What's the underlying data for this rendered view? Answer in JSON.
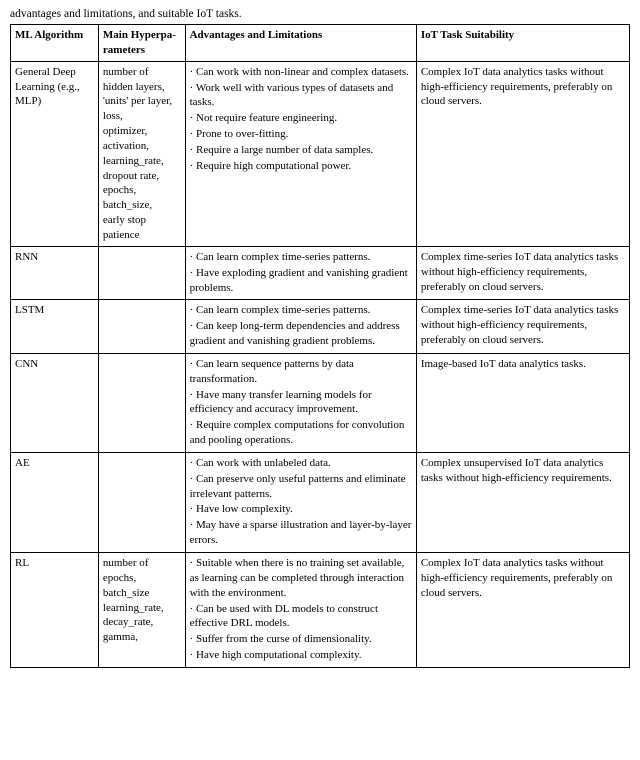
{
  "header": "advantages and limitations, and suitable IoT tasks.",
  "columns": [
    "ML Algorithm",
    "Main Hyperparameters",
    "Advantages and Limitations",
    "IoT Task Suitability"
  ],
  "rows": [
    {
      "algo": "General Deep Learning (e.g., MLP)",
      "params": "number of hidden layers,\n'units' per layer,\nloss,\noptimizer,\nactivation,\nlearning_rate,\ndropout rate,\nepochs,\nbatch_size,\nearly stop patience",
      "advantages": [
        "Can work with non-linear and complex datasets.",
        "Work well with various types of datasets and tasks.",
        "Not require feature engineering.",
        "Prone to over-fitting.",
        "Require a large number of data samples.",
        "Require high computational power."
      ],
      "iot": "Complex IoT data analytics tasks without high-efficiency requirements, preferably on cloud servers."
    },
    {
      "algo": "RNN",
      "params": "",
      "advantages": [
        "Can learn complex time-series patterns.",
        "Have exploding gradient and vanishing gradient problems."
      ],
      "iot": "Complex time-series IoT data analytics tasks without high-efficiency requirements, preferably on cloud servers."
    },
    {
      "algo": "LSTM",
      "params": "",
      "advantages": [
        "Can learn complex time-series patterns.",
        "Can keep long-term dependencies and address gradient and vanishing gradient problems."
      ],
      "iot": "Complex time-series IoT data analytics tasks without high-efficiency requirements, preferably on cloud servers."
    },
    {
      "algo": "CNN",
      "params": "",
      "advantages": [
        "Can learn sequence patterns by data transformation.",
        "Have many transfer learning models for efficiency and accuracy improvement.",
        "Require complex computations for convolution and pooling operations."
      ],
      "iot": "Image-based IoT data analytics tasks."
    },
    {
      "algo": "AE",
      "params": "",
      "advantages": [
        "Can work with unlabeled data.",
        "Can preserve only useful patterns and eliminate irrelevant patterns.",
        "Have low complexity.",
        "May have a sparse illustration and layer-by-layer errors."
      ],
      "iot": "Complex unsupervised IoT data analytics tasks without high-efficiency requirements."
    },
    {
      "algo": "RL",
      "params": "number of epochs,\nbatch_size\nlearning_rate,\ndecay_rate,\ngamma,",
      "advantages": [
        "Suitable when there is no training set available, as learning can be completed through interaction with the environment.",
        "Can be used with DL models to construct effective DRL models.",
        "Suffer from the curse of dimensionality.",
        "Have high computational complexity."
      ],
      "iot": "Complex IoT data analytics tasks without high-efficiency requirements, preferably on cloud servers."
    }
  ]
}
